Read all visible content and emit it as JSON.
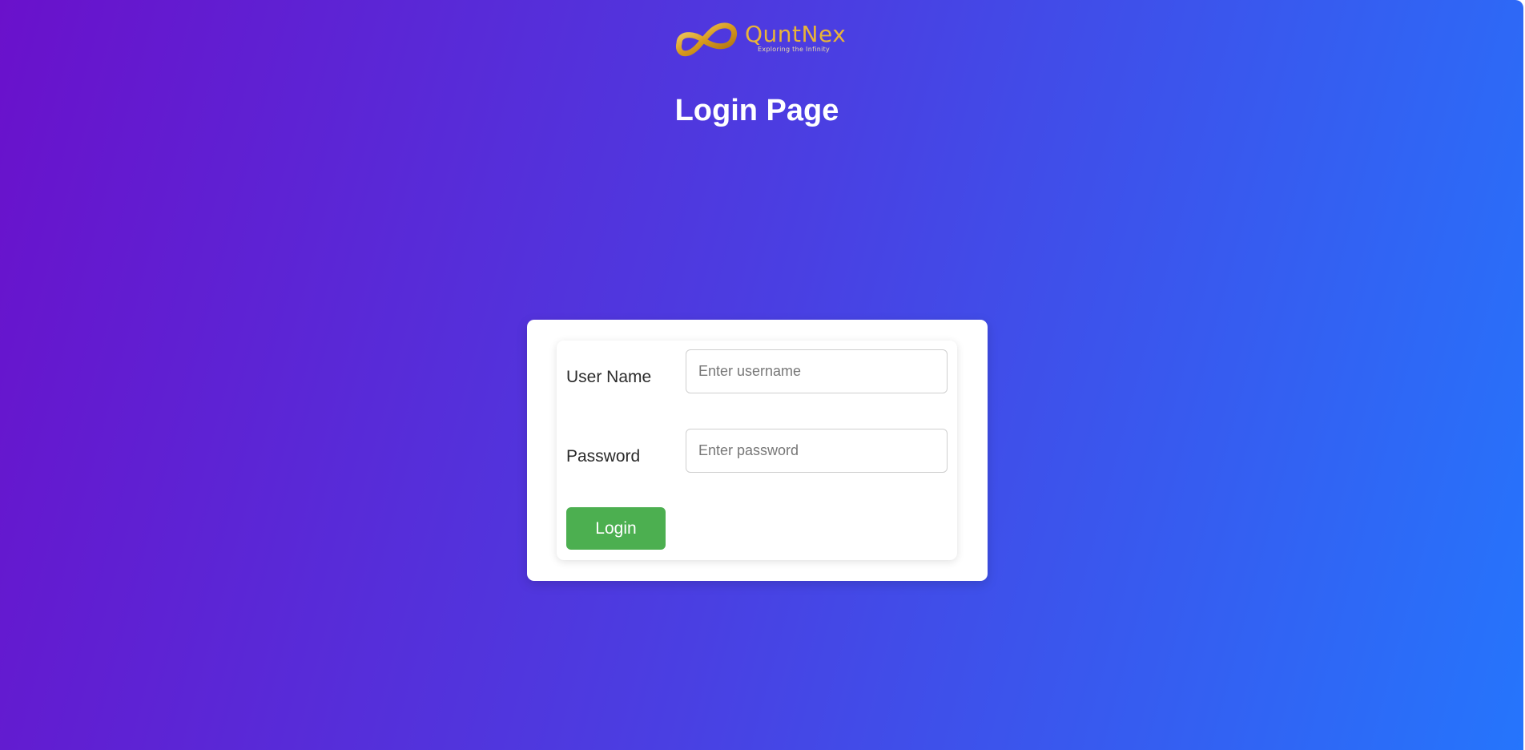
{
  "brand": {
    "name": "QuntNex",
    "tagline": "Exploring the Infinity",
    "logo_icon": "infinity-icon",
    "accent_color": "#e8b33a"
  },
  "page": {
    "title": "Login Page",
    "background_gradient": [
      "#6a11cb",
      "#2575fc"
    ]
  },
  "form": {
    "username": {
      "label": "User Name",
      "value": "",
      "placeholder": "Enter username"
    },
    "password": {
      "label": "Password",
      "value": "",
      "placeholder": "Enter password"
    },
    "login_label": "Login",
    "login_color": "#4caf50"
  }
}
